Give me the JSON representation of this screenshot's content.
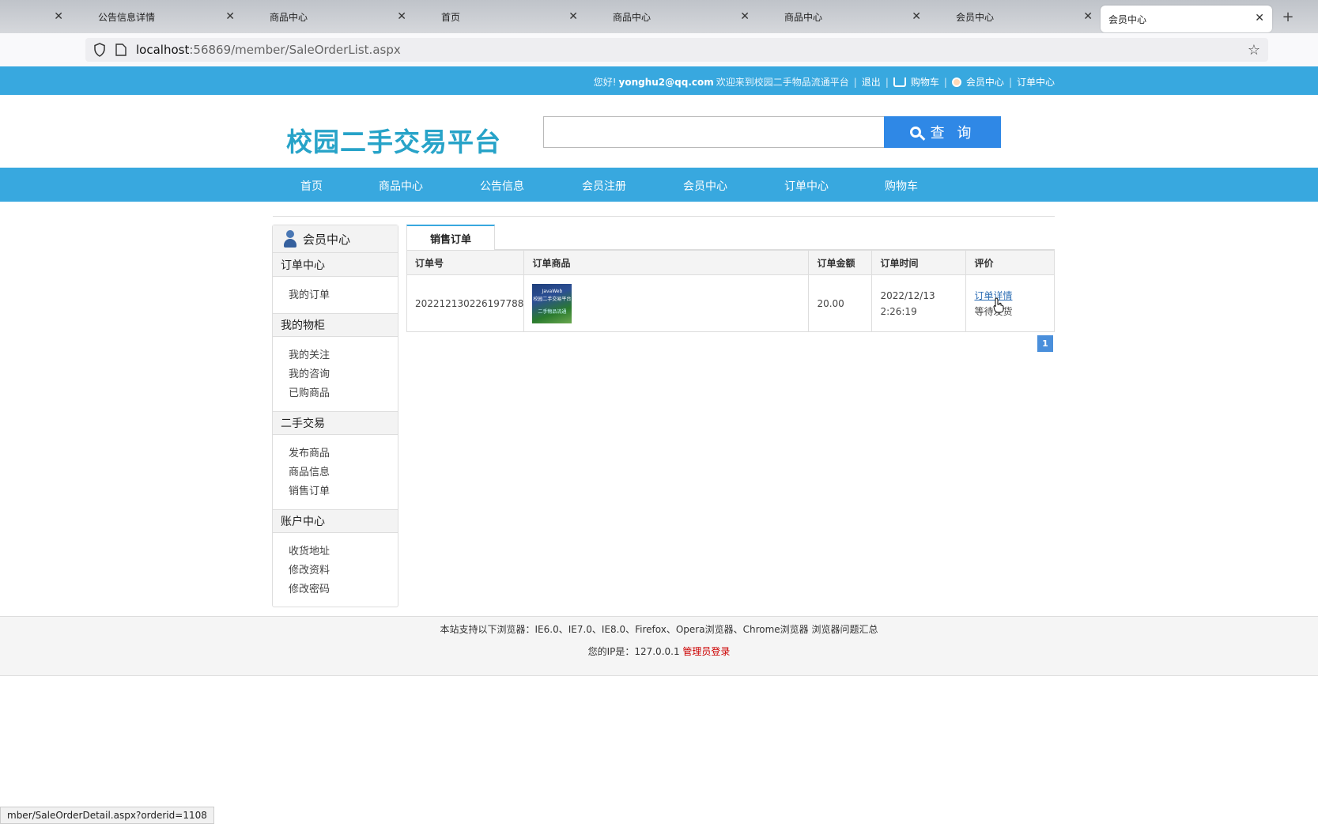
{
  "browser": {
    "tabs": [
      {
        "label": ""
      },
      {
        "label": "公告信息详情"
      },
      {
        "label": "商品中心"
      },
      {
        "label": "首页"
      },
      {
        "label": "商品中心"
      },
      {
        "label": "商品中心"
      },
      {
        "label": "会员中心"
      },
      {
        "label": "会员中心"
      }
    ],
    "new_tab": "+",
    "url_host": "localhost",
    "url_rest": ":56869/member/SaleOrderList.aspx",
    "status_url": "mber/SaleOrderDetail.aspx?orderid=1108"
  },
  "topbar": {
    "greeting": "您好!",
    "email": "yonghu2@qq.com",
    "welcome": "欢迎来到校园二手物品流通平台",
    "logout": "退出",
    "cart": "购物车",
    "member": "会员中心",
    "orders": "订单中心"
  },
  "header": {
    "logo": "校园二手交易平台",
    "search_placeholder": "",
    "search_button": "查 询"
  },
  "nav": [
    "首页",
    "商品中心",
    "公告信息",
    "会员注册",
    "会员中心",
    "订单中心",
    "购物车"
  ],
  "sidebar": {
    "title": "会员中心",
    "groups": [
      {
        "title": "订单中心",
        "items": [
          "我的订单"
        ]
      },
      {
        "title": "我的物柜",
        "items": [
          "我的关注",
          "我的咨询",
          "已购商品"
        ]
      },
      {
        "title": "二手交易",
        "items": [
          "发布商品",
          "商品信息",
          "销售订单"
        ]
      },
      {
        "title": "账户中心",
        "items": [
          "收货地址",
          "修改资料",
          "修改密码"
        ]
      }
    ]
  },
  "main": {
    "tab": "销售订单",
    "columns": [
      "订单号",
      "订单商品",
      "订单金额",
      "订单时间",
      "评价"
    ],
    "rows": [
      {
        "order_no": "202212130226197788",
        "amount": "20.00",
        "date": "2022/12/13",
        "time": "2:26:19",
        "detail_link": "订单详情",
        "status": "等待发货"
      }
    ],
    "page": "1"
  },
  "footer": {
    "browsers": "本站支持以下浏览器：IE6.0、IE7.0、IE8.0、Firefox、Opera浏览器、Chrome浏览器 浏览器问题汇总",
    "ip_label": "您的IP是：127.0.0.1",
    "admin_login": "管理员登录"
  },
  "colors": {
    "accent": "#38a8df",
    "button": "#2f88e6",
    "logo": "#27a3c8"
  }
}
